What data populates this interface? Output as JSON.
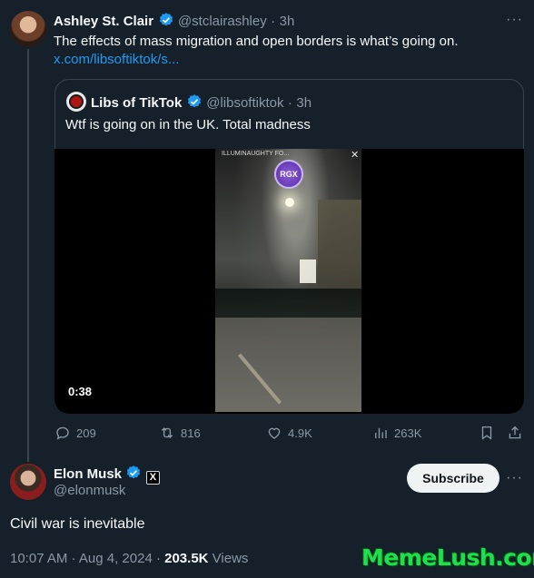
{
  "original_post": {
    "author_name": "Ashley St. Clair",
    "handle": "@stclairashley",
    "time": "3h",
    "text": "The effects of mass migration and open borders is what’s going on.",
    "link": "x.com/libsoftiktok/s..."
  },
  "quoted_post": {
    "author_name": "Libs of TikTok",
    "handle": "@libsoftiktok",
    "time": "3h",
    "text": "Wtf is going on in the UK. Total madness",
    "video": {
      "duration": "0:38",
      "overlay_title": "ILLUMINAUGHTY FO...",
      "overlay_close": "✕",
      "badge": "RGX"
    }
  },
  "actions": {
    "replies": "209",
    "reposts": "816",
    "likes": "4.9K",
    "views": "263K"
  },
  "reply_post": {
    "author_name": "Elon Musk",
    "badge": "X",
    "handle": "@elonmusk",
    "subscribe_label": "Subscribe",
    "text": "Civil war is inevitable",
    "timestamp": "10:07 AM · Aug 4, 2024 · ",
    "views_count": "203.5K",
    "views_label": " Views"
  },
  "more_glyph": "···",
  "watermark": "MemeLush.com",
  "colors": {
    "background": "#15202b",
    "accent": "#1d9bf0",
    "muted": "#8b98a5",
    "border": "#38444d",
    "watermark": "#1ee04a"
  }
}
